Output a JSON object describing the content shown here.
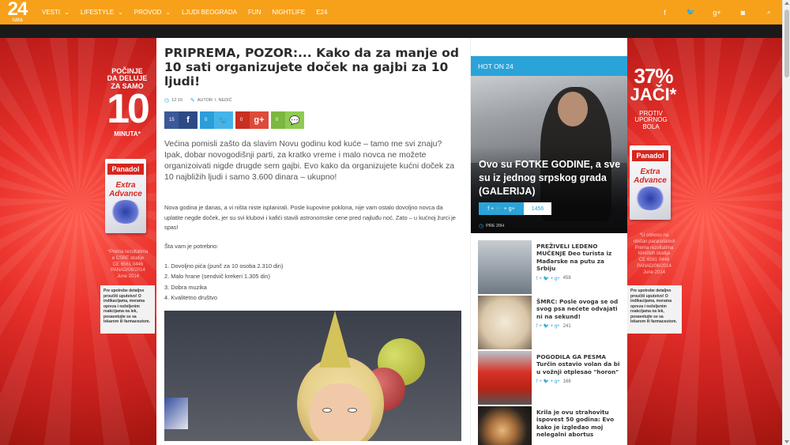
{
  "logo": {
    "number": "24",
    "sub": "sata"
  },
  "nav": [
    {
      "label": "VESTI",
      "dropdown": true
    },
    {
      "label": "LIFESTYLE",
      "dropdown": true
    },
    {
      "label": "PROVOD",
      "dropdown": true
    },
    {
      "label": "LJUDI BEOGRADA",
      "dropdown": false
    },
    {
      "label": "FUN",
      "dropdown": false
    },
    {
      "label": "NIGHTLIFE",
      "dropdown": false
    },
    {
      "label": "E24",
      "dropdown": false
    }
  ],
  "social_icons": [
    "f",
    "t",
    "g+",
    "ig",
    "search"
  ],
  "social_glyphs": {
    "facebook": "f",
    "twitter": "🐦",
    "gplus": "g+",
    "instagram": "◙",
    "search": "⌕"
  },
  "ad_left": {
    "headline": "POČINJE\nDA DELUJE\nZA SAMO",
    "big": "10",
    "unit": "MINUTA*",
    "brand": "Panadol",
    "extra": "Extra\nAdvance",
    "small": "*Prema rezultatima\ne CSBE studije\nCE 6561 0446 PANAD/06/2014\nJune 2014",
    "notice": "Pre upotrebe detaljno proučiti uputstvo! O indikacijama, merama opreza i neželjenim reakcijama na lek, posavetujte se sa lekarom ili farmaceutom."
  },
  "ad_right": {
    "big": "37%",
    "big2": "JAČI*",
    "sub": "PROTIV\nUPORNOG\nBOLA",
    "brand": "Panadol",
    "extra": "Extra\nAdvance",
    "small": "*U odnosu na\nobičan paracetamol\nPrema rezultatima\nkliničkih studija\nCE 6561 0446 PANAD/06/2014\nJune 2014",
    "notice": "Pre upotrebe detaljno proučiti uputstvo! O indikacijama, merama opreza i neželjenim reakcijama na lek, posavetujte se sa lekarom ili farmaceutom."
  },
  "article": {
    "title": "PRIPREMA, POZOR:... Kako da za manje od 10 sati organizujete doček na gajbi za 10 ljudi!",
    "time": "12:10",
    "author": "AUTOR: I. NEDIĆ",
    "shares": {
      "facebook": "15",
      "twitter": "0",
      "gplus": "0",
      "comments": "0"
    },
    "lead": "Većina pomisli zašto da slavim Novu godinu kod kuće – tamo me svi znaju? Ipak, dobar novogodišnji parti, za kratko vreme i malo novca ne možete organizoivati nigde drugde sem gajbi. Evo kako da organizujete kućni doček za 10 najbližih ljudi i samo 3.600 dinara – ukupno!",
    "body1": "Nova godina je danas, a vi ništa niste isplanirali. Posle kupovine poklona, nije vam ostalo dovoljno novca da uplatite negde doček, jer su svi klubovi i kafići stavili astronomske cene pred najluđu noć. Zato – u kućnoj žurci je spas!",
    "body2": "Šta vam je potrebno:",
    "list": [
      "1. Dovoljno pića (punč za 10 osoba 2.310 din)",
      "2. Malo hrane (sendvič krekeri 1.305 din)",
      "3. Dobra muzika",
      "4. Kvalitetno društvo"
    ]
  },
  "sidebar": {
    "header": "HOT ON 24",
    "hero": {
      "title": "Ovo su FOTKE GODINE, a sve su iz jednog srpskog grada (GALERIJA)",
      "share_icons": "f + 🐦 + g+",
      "count": "1456",
      "time": "PRE 20H"
    },
    "items": [
      {
        "title": "PREŽIVELI LEDENO MUČENJE Deo turista iz Mađarske na putu za Srbiju",
        "share": "f + 🐦 + g+",
        "count": "458"
      },
      {
        "title": "ŠMRC: Posle ovoga se od svog psa nećete odvajati ni na sekund!",
        "share": "f + 🐦 + g+",
        "count": "241"
      },
      {
        "title": "POGODILA GA PESMA Turčin ostavio volan da bi u vožnji otplesao \"horon\"",
        "share": "f + 🐦 + g+",
        "count": "166"
      },
      {
        "title": "Krila je ovu strahovitu ispovest 50 godina: Evo kako je izgledao moj nelegalni abortus",
        "share": "",
        "count": ""
      }
    ]
  }
}
